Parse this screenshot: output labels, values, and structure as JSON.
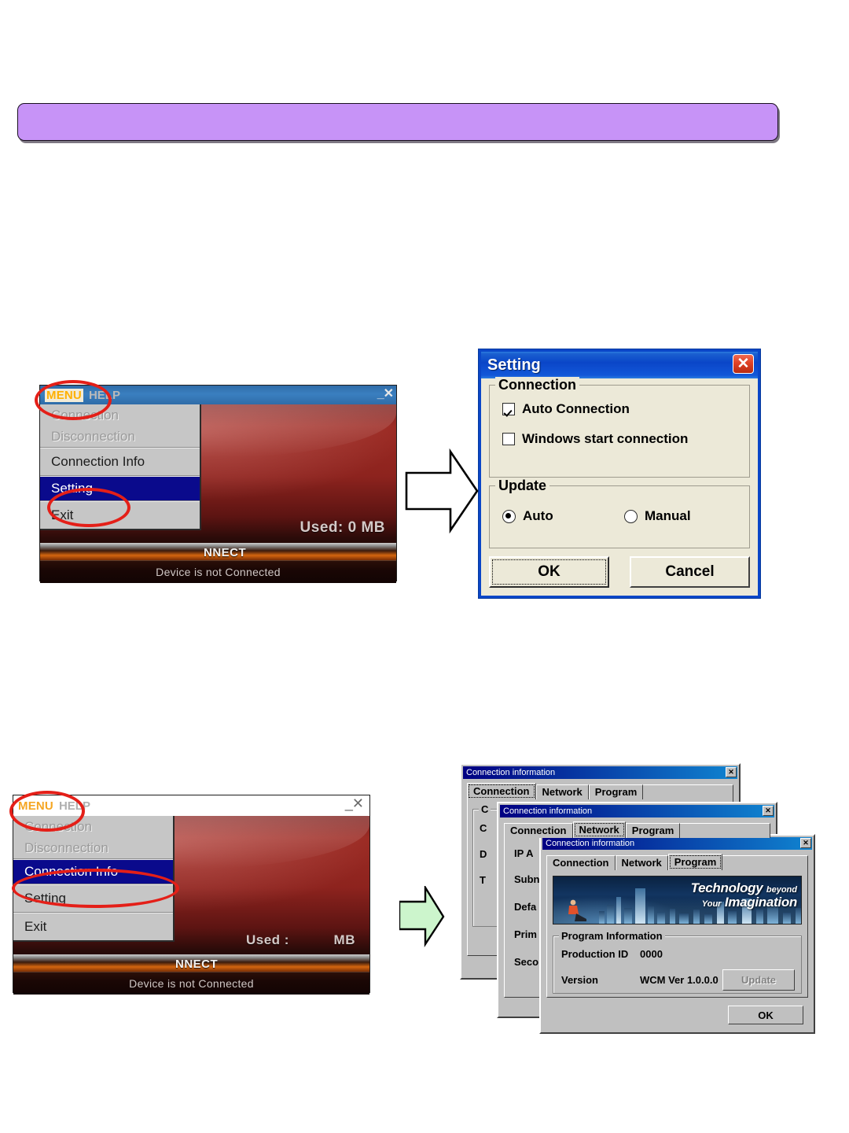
{
  "banner": {
    "text": "",
    "color": "#c793f7"
  },
  "app_window_setting": {
    "menu_label": "MENU",
    "help_label": "HELP",
    "minimize_icon": "minimize-icon",
    "close_icon": "close-icon",
    "used_text": "Used: 0 MB",
    "connect_text": "NNECT",
    "status_text": "Device is not Connected",
    "menu_items": [
      {
        "label": "Connection",
        "state": "disabled"
      },
      {
        "label": "Disconnection",
        "state": "disabled"
      },
      {
        "label": "Connection Info",
        "state": "normal"
      },
      {
        "label": "Setting",
        "state": "selected"
      },
      {
        "label": "Exit",
        "state": "normal"
      }
    ]
  },
  "app_window_info": {
    "menu_label": "MENU",
    "help_label": "HELP",
    "minimize_icon": "minimize-icon",
    "close_icon": "close-icon",
    "used_label": "Used :",
    "used_unit": "MB",
    "connect_text": "NNECT",
    "status_text": "Device is not Connected",
    "menu_items": [
      {
        "label": "Connection",
        "state": "disabled"
      },
      {
        "label": "Disconnection",
        "state": "disabled"
      },
      {
        "label": "Connection Info",
        "state": "selected"
      },
      {
        "label": "Setting",
        "state": "normal"
      },
      {
        "label": "Exit",
        "state": "normal"
      }
    ]
  },
  "setting_dialog": {
    "title": "Setting",
    "close_icon": "close-icon",
    "connection_group": {
      "legend": "Connection",
      "auto_connection": {
        "label": "Auto Connection",
        "checked": true
      },
      "windows_start": {
        "label": "Windows start connection",
        "checked": false
      }
    },
    "update_group": {
      "legend": "Update",
      "auto": {
        "label": "Auto",
        "selected": true
      },
      "manual": {
        "label": "Manual",
        "selected": false
      }
    },
    "ok_label": "OK",
    "cancel_label": "Cancel"
  },
  "conn_info_connection": {
    "title": "Connection information",
    "close_icon": "close-icon",
    "tabs": [
      {
        "label": "Connection",
        "active": true
      },
      {
        "label": "Network",
        "active": false
      },
      {
        "label": "Program",
        "active": false
      }
    ],
    "clipped_labels": [
      "C",
      "C",
      "D",
      "T"
    ]
  },
  "conn_info_network": {
    "title": "Connection information",
    "close_icon": "close-icon",
    "tabs": [
      {
        "label": "Connection",
        "active": false
      },
      {
        "label": "Network",
        "active": true
      },
      {
        "label": "Program",
        "active": false
      }
    ],
    "clipped_labels": [
      "IP A",
      "Subn",
      "Defa",
      "Prim",
      "Seco"
    ]
  },
  "conn_info_program": {
    "title": "Connection information",
    "close_icon": "close-icon",
    "tabs": [
      {
        "label": "Connection",
        "active": false
      },
      {
        "label": "Network",
        "active": false
      },
      {
        "label": "Program",
        "active": true
      }
    ],
    "banner": {
      "line1_strong": "Technology",
      "line1_light": "beyond",
      "line2_light": "Your",
      "line2_strong": "Imagination"
    },
    "group_legend": "Program Information",
    "production_id_label": "Production ID",
    "production_id_value": "0000",
    "version_label": "Version",
    "version_value": "WCM Ver 1.0.0.0",
    "update_label": "Update",
    "update_enabled": false,
    "ok_label": "OK"
  },
  "annotations": {
    "arrow_setting": {
      "icon": "block-arrow-right-icon",
      "fill": "#ffffff"
    },
    "arrow_info": {
      "icon": "block-arrow-right-icon",
      "fill": "#ccf5cc"
    },
    "highlight_color": "#e41f18",
    "ellipses": [
      "menu-highlight-1",
      "setting-item-highlight",
      "menu-highlight-2",
      "connection-info-item-highlight"
    ]
  }
}
